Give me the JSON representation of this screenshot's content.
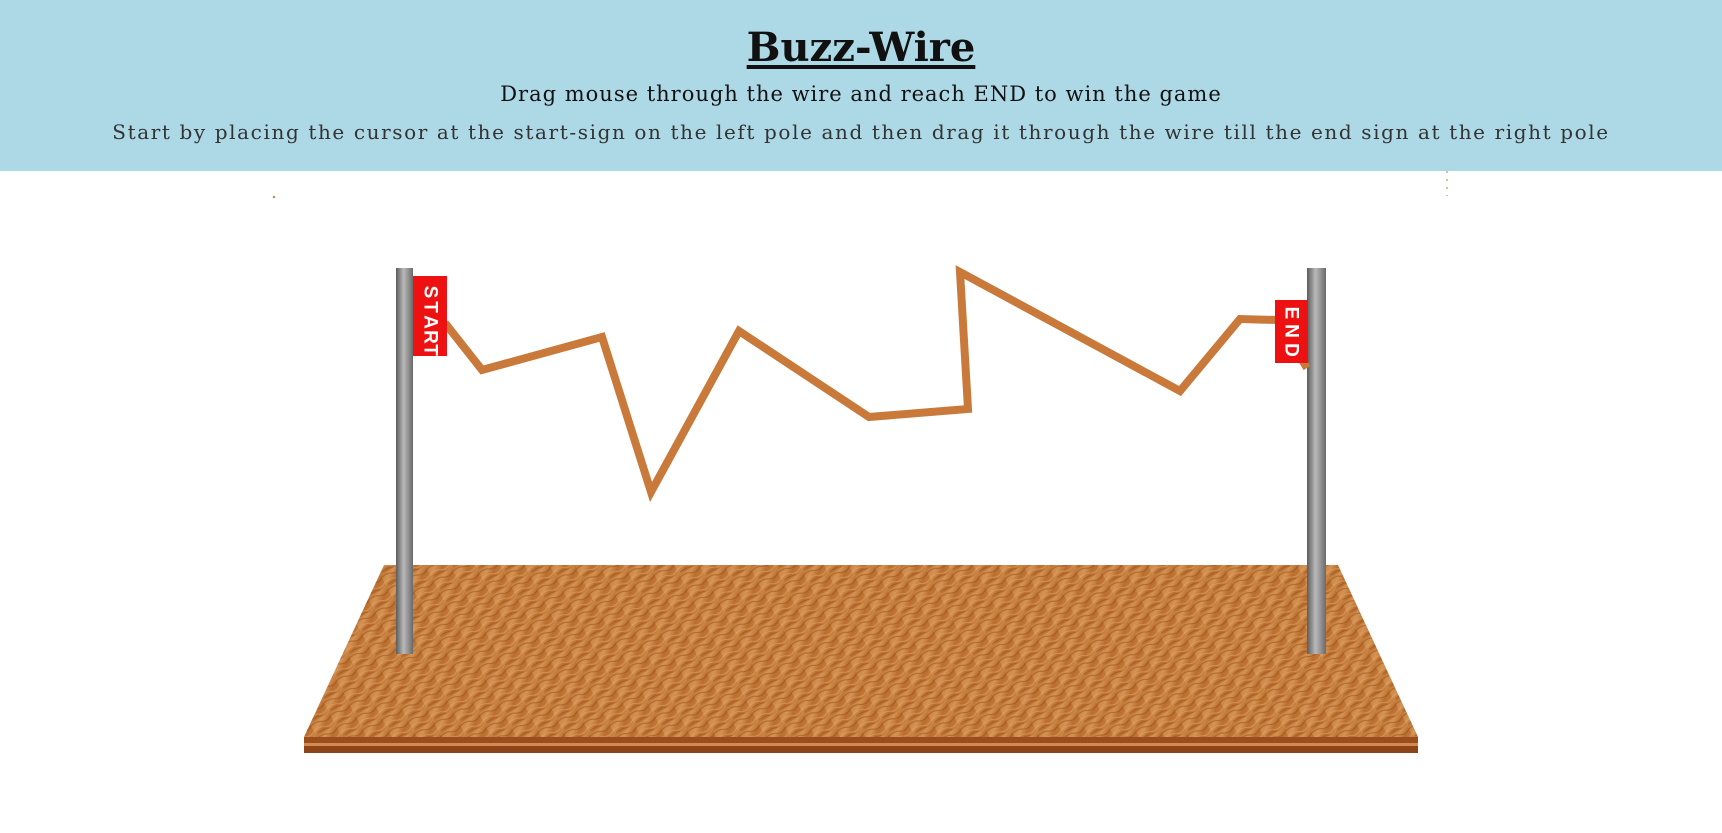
{
  "header": {
    "title": "Buzz-Wire",
    "subtitle": "Drag mouse through the wire and reach END to win the game",
    "instructions": "Start by placing the cursor at the start-sign on the left pole and then drag it through the wire till the end sign at the right pole"
  },
  "game": {
    "start_sign": [
      "S",
      "T",
      "A",
      "R",
      "T"
    ],
    "end_sign": [
      "E",
      "N",
      "D"
    ],
    "colors": {
      "header_bg": "#add8e6",
      "wire": "#c97a3a",
      "sign": "#ee1111",
      "pole": "#8a8a8a",
      "board": "#b8682a"
    }
  }
}
